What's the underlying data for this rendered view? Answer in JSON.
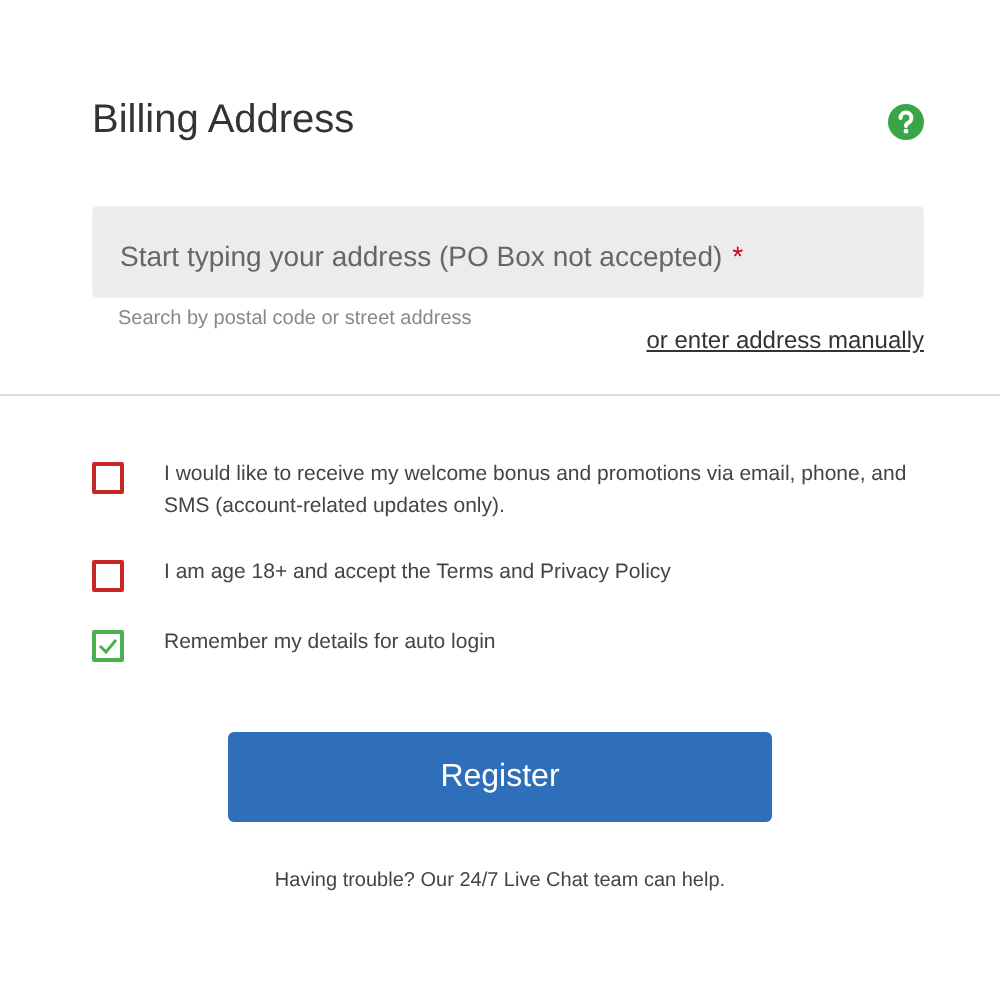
{
  "title": "Billing Address",
  "address_field": {
    "placeholder": "Start typing your address (PO Box not accepted)",
    "required_mark": "*",
    "hint": "Search by postal code or street address"
  },
  "manual_link": "or enter address manually",
  "consents": [
    {
      "text": "I would like to receive my welcome bonus and promotions via email, phone, and SMS (account-related updates only).",
      "checked": false
    },
    {
      "text": "I am age 18+ and accept the Terms and Privacy Policy",
      "checked": false
    },
    {
      "text": "Remember my details for auto login",
      "checked": true
    }
  ],
  "register_button": "Register",
  "help_text": "Having trouble? Our 24/7 Live Chat team can help."
}
